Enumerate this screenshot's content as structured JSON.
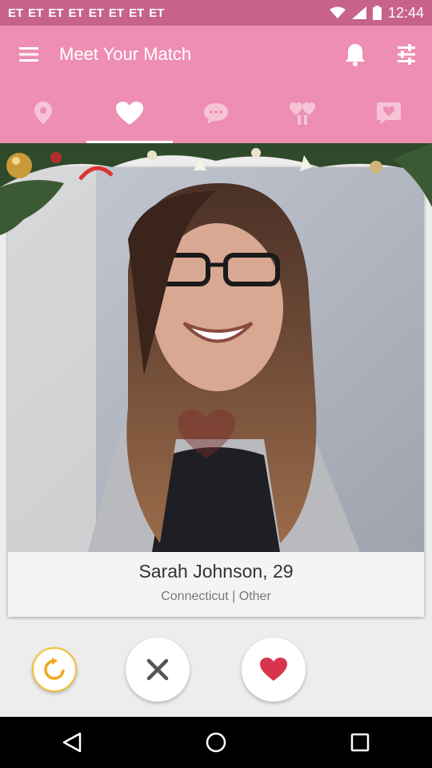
{
  "status_bar": {
    "notification_glyphs": [
      "ET",
      "ET",
      "ET",
      "ET",
      "ET",
      "ET",
      "ET",
      "ET"
    ],
    "time": "12:44"
  },
  "app_bar": {
    "title": "Meet Your Match",
    "menu_icon": "hamburger-menu-icon",
    "actions": [
      "bell-icon",
      "sliders-icon"
    ]
  },
  "tabs": [
    {
      "icon": "location-pin-icon",
      "active": false
    },
    {
      "icon": "heart-icon",
      "active": true
    },
    {
      "icon": "chat-bubble-icon",
      "active": false
    },
    {
      "icon": "two-hearts-icon",
      "active": false
    },
    {
      "icon": "heart-message-icon",
      "active": false
    }
  ],
  "profile": {
    "name_age": "Sarah Johnson, 29",
    "details": "Connecticut  | Other"
  },
  "controls": {
    "refresh_icon": "refresh-icon",
    "nope_icon": "close-icon",
    "like_icon": "heart-icon"
  },
  "colors": {
    "accent": "#ee8eb2",
    "status_bar": "#c7638a",
    "like": "#d8344d",
    "refresh_ring": "#f2c230"
  }
}
